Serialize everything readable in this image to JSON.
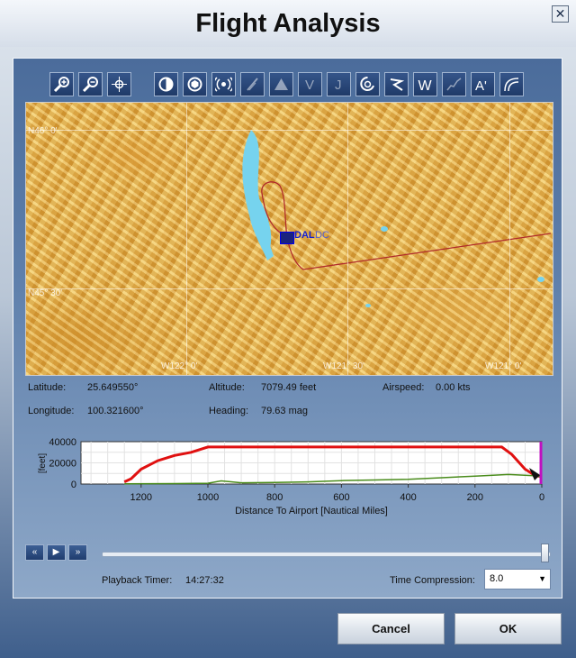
{
  "window": {
    "title": "Flight Analysis",
    "close_glyph": "✕"
  },
  "toolbar": {
    "items": [
      {
        "name": "zoom-in-icon"
      },
      {
        "name": "zoom-out-icon"
      },
      {
        "name": "center-map-icon"
      },
      {
        "name": "day-night-icon"
      },
      {
        "name": "airports-icon"
      },
      {
        "name": "vor-icon"
      },
      {
        "name": "ndb-icon",
        "disabled": true
      },
      {
        "name": "terrain-icon",
        "disabled": true
      },
      {
        "name": "victor-airways-icon",
        "disabled": true
      },
      {
        "name": "jet-airways-icon",
        "disabled": true
      },
      {
        "name": "holding-pattern-icon"
      },
      {
        "name": "flight-path-icon"
      },
      {
        "name": "waypoints-icon",
        "label": "W"
      },
      {
        "name": "altitude-profile-icon",
        "disabled": true
      },
      {
        "name": "labels-icon",
        "label": "A'"
      },
      {
        "name": "approach-icon"
      }
    ]
  },
  "map": {
    "grid_labels": [
      "N46° 0'",
      "N45° 30'",
      "W122° 0'",
      "W121° 30'",
      "W121° 0'"
    ],
    "aircraft_label": "DAL",
    "airport_label": "DC"
  },
  "info": {
    "latitude_label": "Latitude:",
    "latitude": "25.649550°",
    "longitude_label": "Longitude:",
    "longitude": "100.321600°",
    "altitude_label": "Altitude:",
    "altitude": "7079.49 feet",
    "heading_label": "Heading:",
    "heading": "79.63 mag",
    "airspeed_label": "Airspeed:",
    "airspeed": "0.00 kts"
  },
  "chart_data": {
    "type": "line",
    "xlabel": "Distance To Airport [Nautical Miles]",
    "ylabel": "[feet]",
    "xlim": [
      1380,
      0
    ],
    "ylim": [
      0,
      40000
    ],
    "x_ticks": [
      1200,
      1000,
      800,
      600,
      400,
      200,
      0
    ],
    "y_ticks": [
      0,
      20000,
      40000
    ],
    "grid": true,
    "series": [
      {
        "color": "#e01010",
        "x": [
          1250,
          1230,
          1200,
          1150,
          1100,
          1050,
          1000,
          900,
          700,
          500,
          300,
          120,
          90,
          50,
          20,
          0
        ],
        "y": [
          2000,
          5000,
          14000,
          22000,
          27000,
          30000,
          35000,
          35000,
          35000,
          35000,
          35000,
          35000,
          28000,
          14000,
          8000,
          7000
        ]
      },
      {
        "color": "#4a8c1c",
        "x": [
          1250,
          1100,
          1000,
          960,
          900,
          800,
          700,
          600,
          500,
          400,
          300,
          200,
          100,
          30,
          0
        ],
        "y": [
          200,
          400,
          800,
          3000,
          1200,
          1500,
          2000,
          3200,
          3800,
          4500,
          6000,
          7500,
          9000,
          8000,
          7000
        ]
      }
    ]
  },
  "playback": {
    "rewind_glyph": "«",
    "play_glyph": "▶",
    "forward_glyph": "»",
    "position": 1.0,
    "timer_label": "Playback Timer:",
    "timer_value": "14:27:32",
    "compression_label": "Time Compression:",
    "compression_value": "8.0"
  },
  "buttons": {
    "cancel": "Cancel",
    "ok": "OK"
  }
}
